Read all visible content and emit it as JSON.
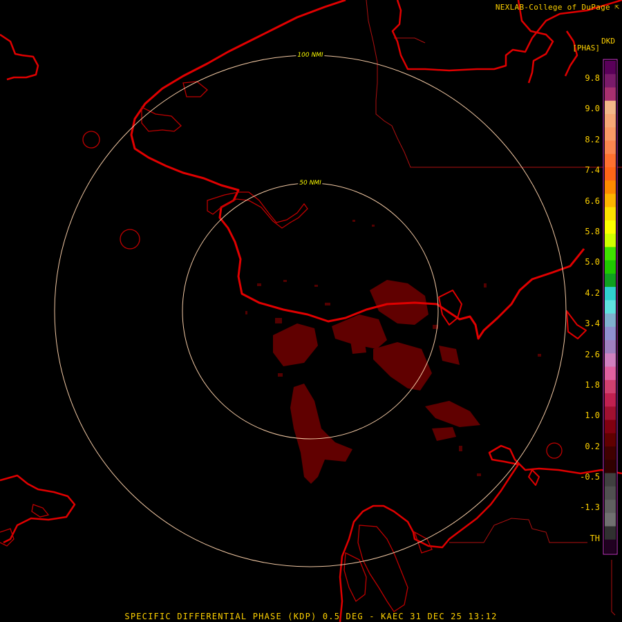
{
  "credit": "NEXLAB-College of DuPage",
  "credit_icon": "arrow-cursor-icon",
  "product_code": "DKD",
  "unit": "[PHAS]",
  "footer": "SPECIFIC DIFFERENTIAL PHASE (KDP) 0.5 DEG - KAEC 31 DEC 25 13:12",
  "range_rings": [
    {
      "label": "100 NMI",
      "range_nmi": 100
    },
    {
      "label": "50 NMI",
      "range_nmi": 50
    }
  ],
  "colorbar": {
    "labels": [
      "9.8",
      "9.0",
      "8.2",
      "7.4",
      "6.6",
      "5.8",
      "5.0",
      "4.2",
      "3.4",
      "2.6",
      "1.8",
      "1.0",
      "0.2",
      "-0.5",
      "-1.3",
      "TH"
    ],
    "colors": [
      "#5a005a",
      "#7a1a6a",
      "#a83070",
      "#f2b889",
      "#f6a877",
      "#f99a66",
      "#fb8650",
      "#ff7030",
      "#ff6518",
      "#ff8a00",
      "#ffb400",
      "#ffe000",
      "#ffff00",
      "#d0ff00",
      "#40e000",
      "#20c800",
      "#10a020",
      "#30d0d0",
      "#60e0e0",
      "#80b0d0",
      "#9090d0",
      "#a080c0",
      "#d080c0",
      "#e060a0",
      "#d04070",
      "#c02050",
      "#a01030",
      "#800010",
      "#600000",
      "#400000",
      "#300000",
      "#404040",
      "#505050",
      "#606060",
      "#707070",
      "#303030",
      "#200020"
    ]
  },
  "colors": {
    "coast": "#e00000",
    "border": "#b01010",
    "ring": "#f3c9a4",
    "echo": "#6a0000",
    "text": "#ffd200"
  }
}
